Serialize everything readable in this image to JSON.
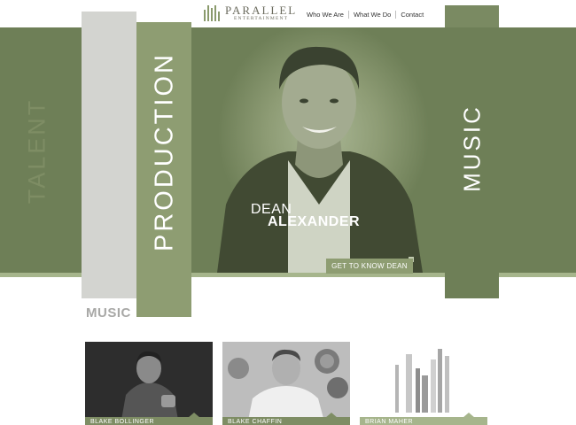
{
  "brand": {
    "name": "PARALLEL",
    "tagline": "ENTERTAINMENT"
  },
  "nav": {
    "items": [
      "Who We Are",
      "What We Do",
      "Contact"
    ]
  },
  "hero": {
    "columns": [
      "TALENT",
      "PRODUCTION",
      "MUSIC"
    ],
    "featured_first": "DEAN",
    "featured_last": "ALEXANDER",
    "cta_label": "GET TO KNOW DEAN"
  },
  "music_section": {
    "title": "MUSIC",
    "cards": [
      {
        "caption": "BLAKE BOLLINGER"
      },
      {
        "caption": "BLAKE CHAFFIN"
      },
      {
        "caption": "BRIAN MAHER"
      }
    ]
  },
  "colors": {
    "accent": "#6e7f57",
    "accent_light": "#8e9d72",
    "talent_column": "#d3d4d0"
  }
}
